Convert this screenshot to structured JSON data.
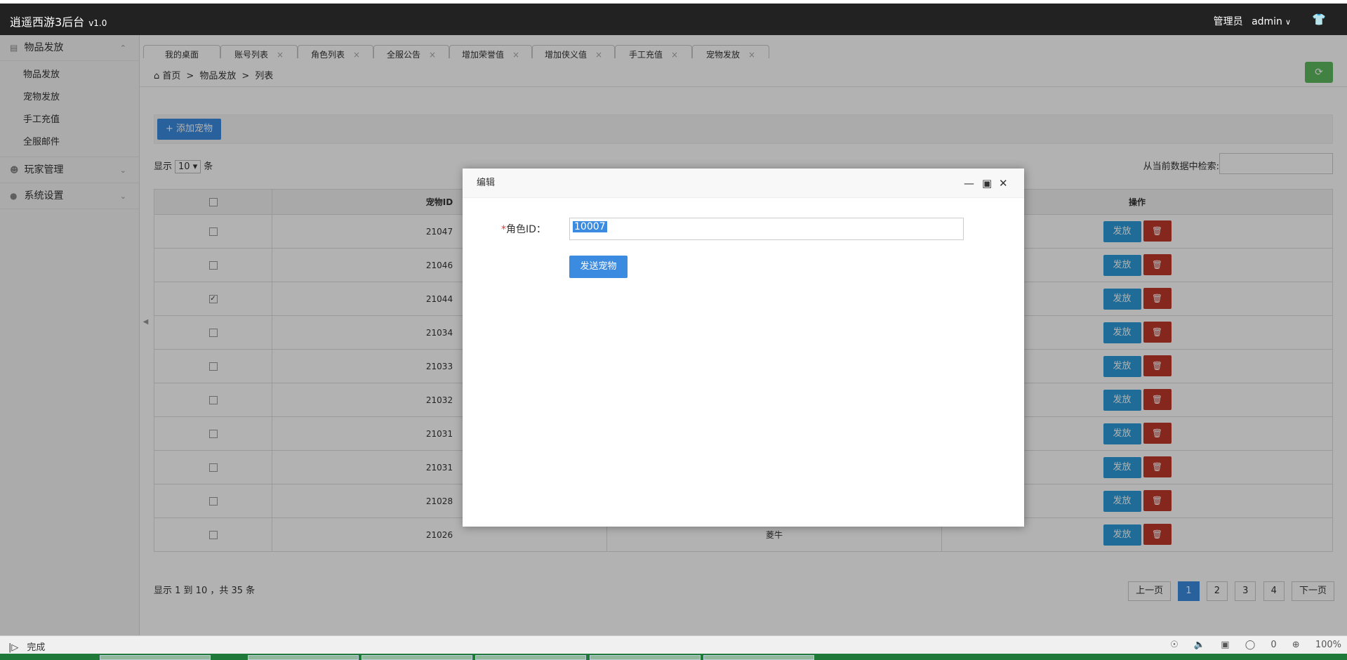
{
  "app": {
    "title": "逍遥西游3后台",
    "version": "v1.0"
  },
  "header": {
    "user_label": "管理员",
    "username": "admin",
    "user_chevron": "∨",
    "shirt_icon": "shirt-icon"
  },
  "sidebar": {
    "group1": {
      "label": "物品发放",
      "items": [
        "物品发放",
        "宠物发放",
        "手工充值",
        "全服邮件"
      ]
    },
    "group2": {
      "label": "玩家管理"
    },
    "group3": {
      "label": "系统设置"
    }
  },
  "tabs": [
    {
      "label": "我的桌面"
    },
    {
      "label": "账号列表"
    },
    {
      "label": "角色列表"
    },
    {
      "label": "全服公告"
    },
    {
      "label": "增加荣誉值"
    },
    {
      "label": "增加侠义值"
    },
    {
      "label": "手工充值"
    },
    {
      "label": "宠物发放"
    }
  ],
  "breadcrumb": {
    "home": "首页",
    "sep": ">",
    "level1": "物品发放",
    "level2": "列表"
  },
  "toolbar": {
    "add_label": "添加宠物",
    "add_plus": "+"
  },
  "list": {
    "show_prefix": "显示",
    "show_value": "10",
    "show_suffix": "条",
    "search_label": "从当前数据中检索:",
    "columns": {
      "pet_id": "宠物ID",
      "ops": "操作"
    },
    "rows": [
      {
        "id": "21047",
        "name": "",
        "checked": false
      },
      {
        "id": "21046",
        "name": "",
        "checked": false
      },
      {
        "id": "21044",
        "name": "",
        "checked": true
      },
      {
        "id": "21034",
        "name": "",
        "checked": false
      },
      {
        "id": "21033",
        "name": "",
        "checked": false
      },
      {
        "id": "21032",
        "name": "",
        "checked": false
      },
      {
        "id": "21031",
        "name": "",
        "checked": false
      },
      {
        "id": "21031",
        "name": "",
        "checked": false
      },
      {
        "id": "21028",
        "name": "",
        "checked": false
      },
      {
        "id": "21026",
        "name": "菱牛",
        "checked": false
      }
    ],
    "send_label": "发放",
    "footer": "显示 1 到 10 ，共 35 条",
    "pager": {
      "prev": "上一页",
      "pages": [
        "1",
        "2",
        "3",
        "4"
      ],
      "next": "下一页"
    }
  },
  "modal": {
    "title": "编辑",
    "field_required": "*",
    "field_label": "角色ID：",
    "field_value": "10007",
    "submit_label": "发送宠物"
  },
  "statusbar": {
    "status": "完成",
    "count": "0",
    "zoom": "100%"
  },
  "colors": {
    "accent": "#3b8be0",
    "danger": "#c0392b",
    "success": "#5eb95e",
    "topbar": "#222222"
  }
}
